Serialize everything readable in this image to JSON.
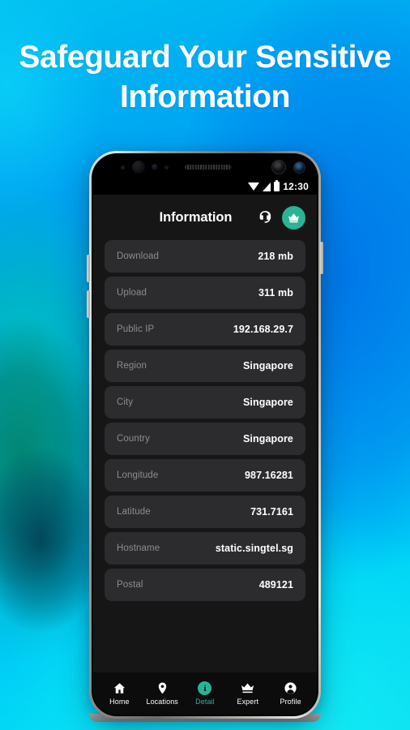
{
  "poster": {
    "headline": "Safeguard Your Sensitive Information",
    "accent_color": "#2bb396",
    "bg_blue": "#00a2f3",
    "bg_cyan": "#14f0f5",
    "bg_teal": "#02806e"
  },
  "status_bar": {
    "time": "12:30",
    "wifi_icon": "wifi-icon",
    "signal_icon": "cellular-signal-icon",
    "battery_icon": "battery-icon"
  },
  "app": {
    "header": {
      "title": "Information",
      "support_icon": "headset-support-icon",
      "premium_icon": "crown-icon"
    },
    "rows": [
      {
        "label": "Download",
        "value": "218 mb"
      },
      {
        "label": "Upload",
        "value": "311 mb"
      },
      {
        "label": "Public IP",
        "value": "192.168.29.7"
      },
      {
        "label": "Region",
        "value": "Singapore"
      },
      {
        "label": "City",
        "value": "Singapore"
      },
      {
        "label": "Country",
        "value": "Singapore"
      },
      {
        "label": "Longitude",
        "value": "987.16281"
      },
      {
        "label": "Latitude",
        "value": "731.7161"
      },
      {
        "label": "Hostname",
        "value": "static.singtel.sg"
      },
      {
        "label": "Postal",
        "value": "489121"
      }
    ],
    "bottom_nav": {
      "active_index": 2,
      "items": [
        {
          "label": "Home",
          "icon": "home-icon"
        },
        {
          "label": "Locations",
          "icon": "map-pin-icon"
        },
        {
          "label": "Detail",
          "icon": "info-icon"
        },
        {
          "label": "Expert",
          "icon": "crown-icon"
        },
        {
          "label": "Profile",
          "icon": "person-badge-icon"
        }
      ]
    }
  }
}
